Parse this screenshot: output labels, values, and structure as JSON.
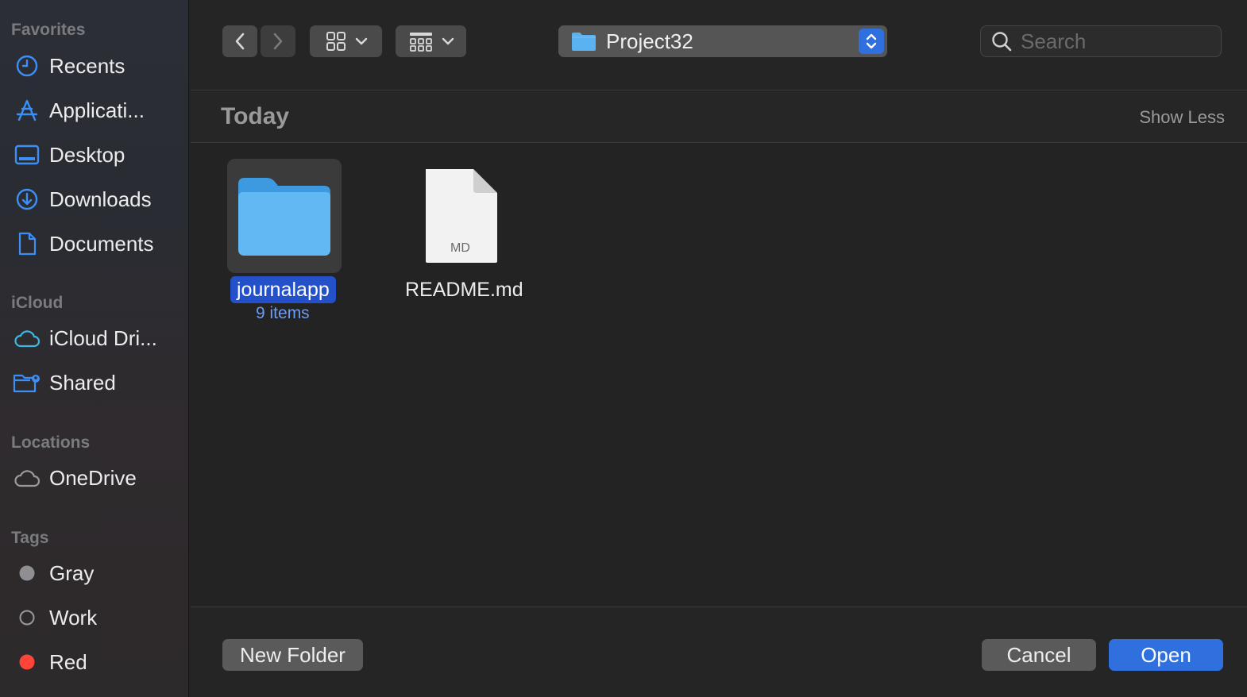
{
  "sidebar": {
    "favorites_title": "Favorites",
    "favorites": [
      {
        "label": "Recents",
        "icon": "clock-icon"
      },
      {
        "label": "Applicati...",
        "icon": "applications-icon"
      },
      {
        "label": "Desktop",
        "icon": "desktop-icon"
      },
      {
        "label": "Downloads",
        "icon": "download-icon"
      },
      {
        "label": "Documents",
        "icon": "document-icon"
      }
    ],
    "icloud_title": "iCloud",
    "icloud": [
      {
        "label": "iCloud Dri...",
        "icon": "cloud-icon"
      },
      {
        "label": "Shared",
        "icon": "shared-folder-icon"
      }
    ],
    "locations_title": "Locations",
    "locations": [
      {
        "label": "OneDrive",
        "icon": "cloud-icon"
      }
    ],
    "tags_title": "Tags",
    "tags": [
      {
        "label": "Gray",
        "color": "#8e8e93"
      },
      {
        "label": "Work",
        "color": "hollow"
      },
      {
        "label": "Red",
        "color": "#ff453a"
      }
    ]
  },
  "toolbar": {
    "path": "Project32",
    "search_placeholder": "Search"
  },
  "group": {
    "title": "Today",
    "toggle": "Show Less"
  },
  "files": [
    {
      "name": "journalapp",
      "sub": "9 items",
      "type": "folder",
      "selected": true
    },
    {
      "name": "README.md",
      "type": "md",
      "badge": "MD"
    }
  ],
  "footer": {
    "new_folder": "New Folder",
    "cancel": "Cancel",
    "open": "Open"
  },
  "colors": {
    "accent": "#2f6fde",
    "sidebar_icon": "#3b8ff5",
    "folder": "#5ab2f0"
  }
}
